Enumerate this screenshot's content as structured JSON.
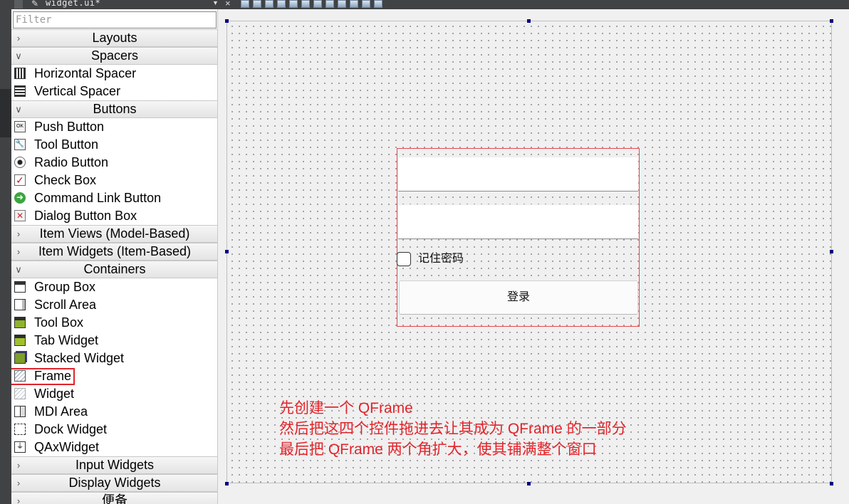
{
  "topbar": {
    "file_title": "widget.ui*",
    "icons": [
      "pencil-file-icon",
      "dropdown-arrow-icon",
      "close-icon",
      "toolbar-icons"
    ]
  },
  "widget_box": {
    "filter_placeholder": "Filter",
    "sections": [
      {
        "label": "Layouts",
        "expanded": false,
        "items": []
      },
      {
        "label": "Spacers",
        "expanded": true,
        "items": [
          {
            "label": "Horizontal Spacer",
            "icon": "horizontal-spacer-icon"
          },
          {
            "label": "Vertical Spacer",
            "icon": "vertical-spacer-icon"
          }
        ]
      },
      {
        "label": "Buttons",
        "expanded": true,
        "items": [
          {
            "label": "Push Button",
            "icon": "push-button-icon",
            "glyph": "OK"
          },
          {
            "label": "Tool Button",
            "icon": "tool-button-icon",
            "glyph": "🔧"
          },
          {
            "label": "Radio Button",
            "icon": "radio-button-icon",
            "glyph": ""
          },
          {
            "label": "Check Box",
            "icon": "check-box-icon",
            "glyph": "✓"
          },
          {
            "label": "Command Link Button",
            "icon": "command-link-icon",
            "glyph": "➜"
          },
          {
            "label": "Dialog Button Box",
            "icon": "dialog-button-box-icon",
            "glyph": "✕"
          }
        ]
      },
      {
        "label": "Item Views (Model-Based)",
        "expanded": false,
        "items": []
      },
      {
        "label": "Item Widgets (Item-Based)",
        "expanded": false,
        "items": []
      },
      {
        "label": "Containers",
        "expanded": true,
        "items": [
          {
            "label": "Group Box",
            "icon": "group-box-icon"
          },
          {
            "label": "Scroll Area",
            "icon": "scroll-area-icon"
          },
          {
            "label": "Tool Box",
            "icon": "tool-box-icon"
          },
          {
            "label": "Tab Widget",
            "icon": "tab-widget-icon"
          },
          {
            "label": "Stacked Widget",
            "icon": "stacked-widget-icon"
          },
          {
            "label": "Frame",
            "icon": "frame-icon",
            "highlighted": true
          },
          {
            "label": "Widget",
            "icon": "widget-icon"
          },
          {
            "label": "MDI Area",
            "icon": "mdi-area-icon"
          },
          {
            "label": "Dock Widget",
            "icon": "dock-widget-icon"
          },
          {
            "label": "QAxWidget",
            "icon": "qaxwidget-icon",
            "glyph": "⏚"
          }
        ]
      },
      {
        "label": "Input Widgets",
        "expanded": false,
        "items": []
      },
      {
        "label": "Display Widgets",
        "expanded": false,
        "items": []
      },
      {
        "label": "便备",
        "expanded": false,
        "items": []
      }
    ]
  },
  "form": {
    "checkbox_label": "记住密码",
    "checkbox_checked": false,
    "login_button": "登录",
    "username_value": "",
    "password_value": ""
  },
  "annotation": {
    "lines": [
      "先创建一个 QFrame",
      "然后把这四个控件拖进去让其成为 QFrame 的一部分",
      "最后把 QFrame 两个角扩大，使其铺满整个窗口"
    ],
    "color": "#e3242b"
  },
  "colors": {
    "selection_handle": "#000080",
    "frame_border": "#e8474d",
    "highlight_box": "#e0242a"
  }
}
